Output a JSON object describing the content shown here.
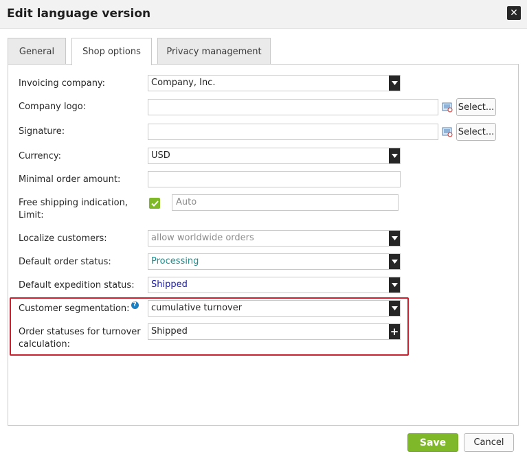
{
  "dialog": {
    "title": "Edit language version",
    "close_icon": "close-icon"
  },
  "tabs": [
    {
      "label": "General",
      "active": false
    },
    {
      "label": "Shop options",
      "active": true
    },
    {
      "label": "Privacy management",
      "active": false
    }
  ],
  "form": {
    "invoicing_company": {
      "label": "Invoicing company:",
      "value": "Company, Inc."
    },
    "company_logo": {
      "label": "Company logo:",
      "value": "",
      "button": "Select..."
    },
    "signature": {
      "label": "Signature:",
      "value": "",
      "button": "Select..."
    },
    "currency": {
      "label": "Currency:",
      "value": "USD"
    },
    "minimal_order_amount": {
      "label": "Minimal order amount:",
      "value": ""
    },
    "free_shipping": {
      "label_line1": "Free shipping indication,",
      "label_line2": "Limit:",
      "checked": true,
      "limit_placeholder": "Auto"
    },
    "localize_customers": {
      "label": "Localize customers:",
      "value": "allow worldwide orders"
    },
    "default_order_status": {
      "label": "Default order status:",
      "value": "Processing"
    },
    "default_expedition_status": {
      "label": "Default expedition status:",
      "value": "Shipped"
    },
    "customer_segmentation": {
      "label": "Customer segmentation:",
      "help": "?",
      "value": "cumulative turnover"
    },
    "order_statuses_turnover": {
      "label_line1": "Order statuses for turnover",
      "label_line2": "calculation:",
      "value": "Shipped",
      "add": "+"
    }
  },
  "footer": {
    "save": "Save",
    "cancel": "Cancel"
  },
  "colors": {
    "accent_green": "#7fb92a",
    "highlight_red": "#c8202c",
    "processing_teal": "#1e8f8f",
    "shipped_blue": "#1a1aa6"
  }
}
